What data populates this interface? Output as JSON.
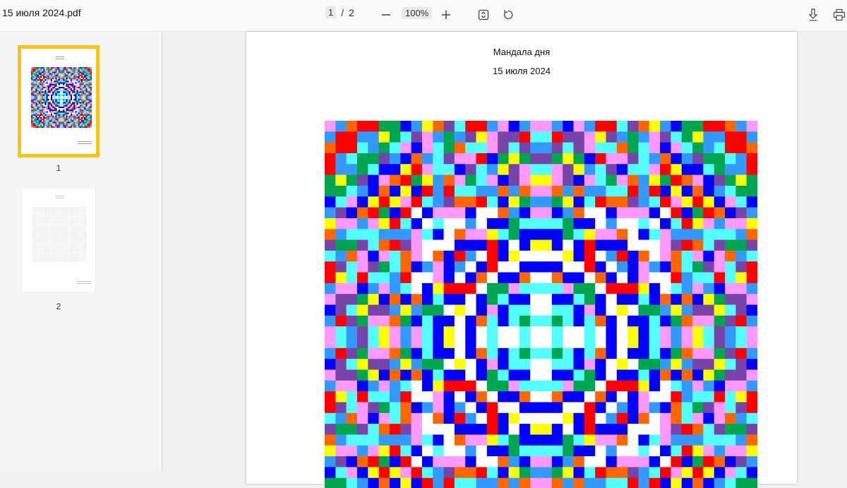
{
  "toolbar": {
    "file_name": "15 июля 2024.pdf",
    "current_page": "1",
    "page_separator": "/",
    "total_pages": "2",
    "zoom_out_icon": "minus-icon",
    "zoom_level": "100%",
    "zoom_in_icon": "plus-icon",
    "fit_icon": "fit-page-icon",
    "rotate_icon": "rotate-icon",
    "download_icon": "download-icon",
    "print_icon": "print-icon"
  },
  "sidebar": {
    "thumbnails": [
      {
        "label": "1",
        "selected": true
      },
      {
        "label": "2",
        "selected": false
      }
    ],
    "selected_color": "#f8c21b"
  },
  "document": {
    "title": "Мандала дня",
    "date": "15 июля 2024"
  },
  "mandala": {
    "palette": [
      "#ff0000",
      "#0000ff",
      "#ffff00",
      "#00a550",
      "#ff99ff",
      "#55ffff",
      "#3399ff",
      "#ff6600",
      "#7744aa",
      "#ffffff"
    ]
  }
}
